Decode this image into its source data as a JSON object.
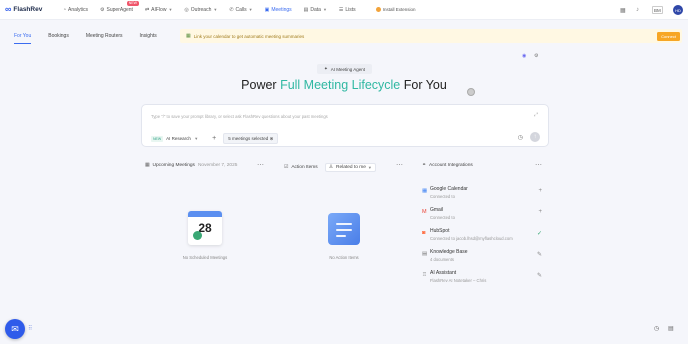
{
  "app": {
    "name": "FlashRev"
  },
  "nav": {
    "items": [
      {
        "label": "Analytics",
        "icon": "analytics-icon"
      },
      {
        "label": "SuperAgent",
        "icon": "robot-icon",
        "badge": "NEW"
      },
      {
        "label": "AIFlow",
        "icon": "flow-icon"
      },
      {
        "label": "Outreach",
        "icon": "outreach-icon"
      },
      {
        "label": "Calls",
        "icon": "phone-icon"
      },
      {
        "label": "Meetings",
        "icon": "meetings-icon"
      },
      {
        "label": "Data",
        "icon": "data-icon"
      },
      {
        "label": "Lists",
        "icon": "lists-icon"
      }
    ],
    "active": "Meetings",
    "extension_label": "Install Extension",
    "brand_text": "BM",
    "avatar_text": "HD"
  },
  "subnav": {
    "tabs": [
      "For You",
      "Bookings",
      "Meeting Routers",
      "Insights"
    ],
    "active": "For You"
  },
  "banner": {
    "text": "Link your calendar to get automatic meeting summaries",
    "button": "Connect"
  },
  "hero": {
    "chip": "AI Meeting Agent",
    "title_prefix": "Power ",
    "title_accent": "Full Meeting Lifecycle",
    "title_suffix": " For You"
  },
  "prompt": {
    "placeholder": "Type \"/\" to save your prompt library, or select ask FlashRev questions about your past meetings",
    "new_tag": "NEW",
    "mode": "AI Research",
    "meetings_chip": "5 meetings selected"
  },
  "upcoming": {
    "title": "Upcoming Meetings",
    "date": "November 7, 2025",
    "empty": "No Scheduled Meetings",
    "calendar_day": "28"
  },
  "actions": {
    "title": "Action Items",
    "filter": "Related to me",
    "empty": "No Action Items"
  },
  "integrations": {
    "title": "Account Integrations",
    "items": [
      {
        "name": "Google Calendar",
        "status": "Connected to",
        "action": "+"
      },
      {
        "name": "Gmail",
        "status": "Connected to",
        "action": "+"
      },
      {
        "name": "HubSpot",
        "status": "Connected to jacob.lhsd@myflashcloud.com",
        "action": "✓"
      },
      {
        "name": "Knowledge Base",
        "status": "4 documents",
        "action": "✎"
      },
      {
        "name": "AI Assistant",
        "status": "FlashRev AI Notetaker – Chris",
        "action": "✎"
      }
    ]
  },
  "colors": {
    "accent": "#3b6cf0",
    "headline_accent": "#30b8a2",
    "banner_bg": "#fff8e3",
    "connect": "#f7a625"
  }
}
